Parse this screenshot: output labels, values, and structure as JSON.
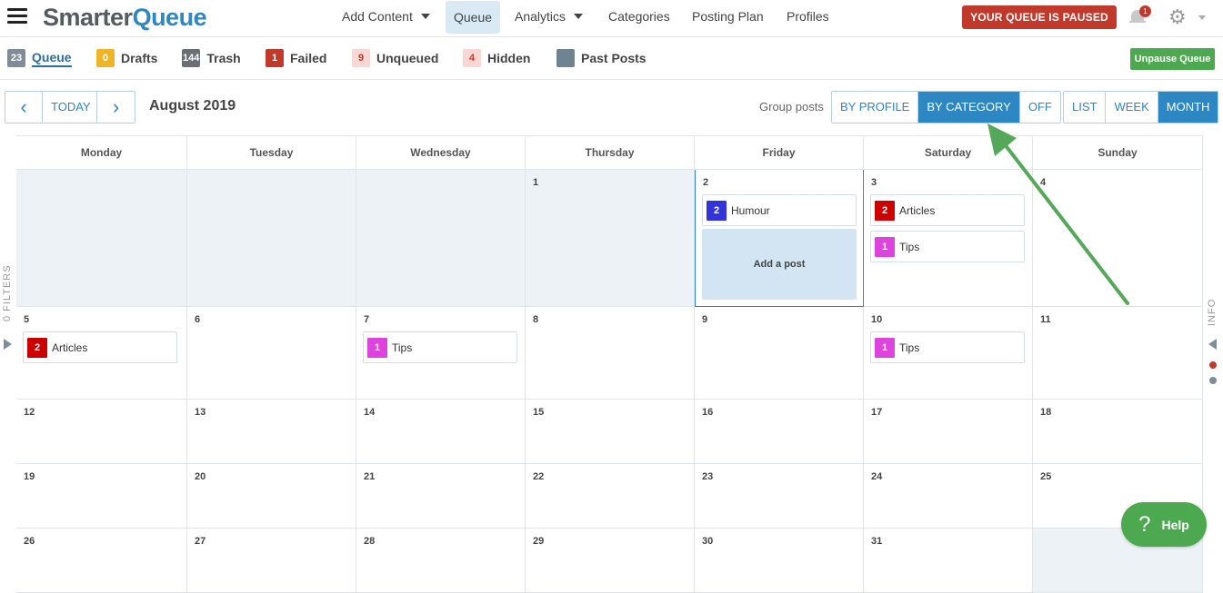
{
  "app": {
    "logo_part1": "Smarter",
    "logo_part2": "Queue"
  },
  "nav": {
    "items": [
      {
        "label": "Add Content",
        "dropdown": true
      },
      {
        "label": "Queue",
        "active": true
      },
      {
        "label": "Analytics",
        "dropdown": true
      },
      {
        "label": "Categories"
      },
      {
        "label": "Posting Plan"
      },
      {
        "label": "Profiles"
      }
    ],
    "paused_label": "YOUR QUEUE IS PAUSED",
    "notification_count": "1"
  },
  "tabs": [
    {
      "count": "23",
      "label": "Queue",
      "color": "#7f8c9a",
      "text": "#fff",
      "active": true
    },
    {
      "count": "0",
      "label": "Drafts",
      "color": "#f0b429",
      "text": "#fff"
    },
    {
      "count": "144",
      "label": "Trash",
      "color": "#6b6f73",
      "text": "#fff"
    },
    {
      "count": "1",
      "label": "Failed",
      "color": "#c0392b",
      "text": "#fff"
    },
    {
      "count": "9",
      "label": "Unqueued",
      "color": "#f8d7d4",
      "text": "#c0392b"
    },
    {
      "count": "4",
      "label": "Hidden",
      "color": "#f8d7d4",
      "text": "#c0392b"
    },
    {
      "count": "",
      "label": "Past Posts",
      "color": "#6f8391",
      "text": "#fff"
    }
  ],
  "unpause_label": "Unpause Queue",
  "toolbar": {
    "prev": "‹",
    "today": "TODAY",
    "next": "›",
    "month_title": "August 2019",
    "group_label": "Group posts",
    "group_options": [
      {
        "label": "BY PROFILE"
      },
      {
        "label": "BY CATEGORY",
        "active": true
      },
      {
        "label": "OFF"
      }
    ],
    "view_options": [
      {
        "label": "LIST"
      },
      {
        "label": "WEEK"
      },
      {
        "label": "MONTH",
        "active": true
      }
    ]
  },
  "side": {
    "filters_label": "0 FILTERS",
    "info_label": "INFO",
    "dot_colors": [
      "#c0392b",
      "#7f8c9a"
    ]
  },
  "calendar": {
    "weekdays": [
      "Monday",
      "Tuesday",
      "Wednesday",
      "Thursday",
      "Friday",
      "Saturday",
      "Sunday"
    ],
    "add_post_label": "Add a post",
    "category_colors": {
      "Humour": "#3333dd",
      "Articles": "#cc0000",
      "Tips": "#dd44dd"
    },
    "weeks": [
      [
        {
          "day": "",
          "past": true
        },
        {
          "day": "",
          "past": true
        },
        {
          "day": "",
          "past": true
        },
        {
          "day": "1",
          "past": true
        },
        {
          "day": "2",
          "today": true,
          "add_post": true,
          "posts": [
            {
              "count": "2",
              "category": "Humour"
            }
          ]
        },
        {
          "day": "3",
          "posts": [
            {
              "count": "2",
              "category": "Articles"
            },
            {
              "count": "1",
              "category": "Tips"
            }
          ]
        },
        {
          "day": "4"
        }
      ],
      [
        {
          "day": "5",
          "posts": [
            {
              "count": "2",
              "category": "Articles"
            }
          ]
        },
        {
          "day": "6"
        },
        {
          "day": "7",
          "posts": [
            {
              "count": "1",
              "category": "Tips"
            }
          ]
        },
        {
          "day": "8"
        },
        {
          "day": "9"
        },
        {
          "day": "10",
          "posts": [
            {
              "count": "1",
              "category": "Tips"
            }
          ]
        },
        {
          "day": "11"
        }
      ],
      [
        {
          "day": "12"
        },
        {
          "day": "13"
        },
        {
          "day": "14"
        },
        {
          "day": "15"
        },
        {
          "day": "16"
        },
        {
          "day": "17"
        },
        {
          "day": "18"
        }
      ],
      [
        {
          "day": "19"
        },
        {
          "day": "20"
        },
        {
          "day": "21"
        },
        {
          "day": "22"
        },
        {
          "day": "23"
        },
        {
          "day": "24"
        },
        {
          "day": "25"
        }
      ],
      [
        {
          "day": "26"
        },
        {
          "day": "27"
        },
        {
          "day": "28"
        },
        {
          "day": "29"
        },
        {
          "day": "30"
        },
        {
          "day": "31"
        },
        {
          "day": "",
          "past": true
        }
      ]
    ]
  },
  "help_label": "Help",
  "help_icon": "?"
}
